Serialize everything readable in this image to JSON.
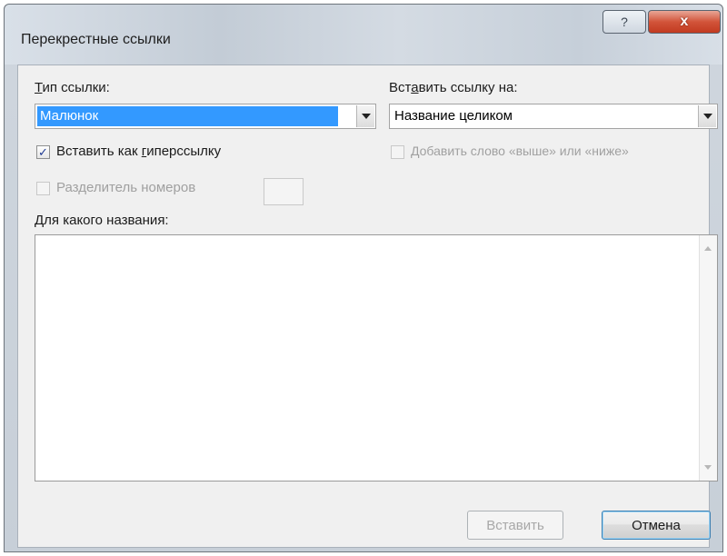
{
  "window": {
    "title": "Перекрестные ссылки",
    "help_glyph": "?",
    "close_glyph": "x"
  },
  "ref_type": {
    "label_pre": "",
    "label_accel": "Т",
    "label_post": "ип ссылки:",
    "value": "Малюнок"
  },
  "insert_ref_to": {
    "label_pre": "Вст",
    "label_accel": "а",
    "label_post": "вить ссылку на:",
    "value": "Название целиком"
  },
  "hyperlink_checkbox": {
    "label_pre": "Вставить как ",
    "label_accel": "г",
    "label_post": "иперссылку",
    "checked": true,
    "mark": "✓"
  },
  "above_below_checkbox": {
    "label": "Добавить слово «выше» или «ниже»",
    "checked": false
  },
  "separator_checkbox": {
    "label": "Разделитель номеров",
    "checked": false
  },
  "for_which_caption": {
    "label_pre": "",
    "label_accel": "Д",
    "label_post": "ля какого названия:",
    "items": []
  },
  "buttons": {
    "insert_label": "Вставить",
    "cancel_label": "Отмена"
  },
  "colors": {
    "selection": "#3399ff",
    "close_button": "#c23a20"
  }
}
